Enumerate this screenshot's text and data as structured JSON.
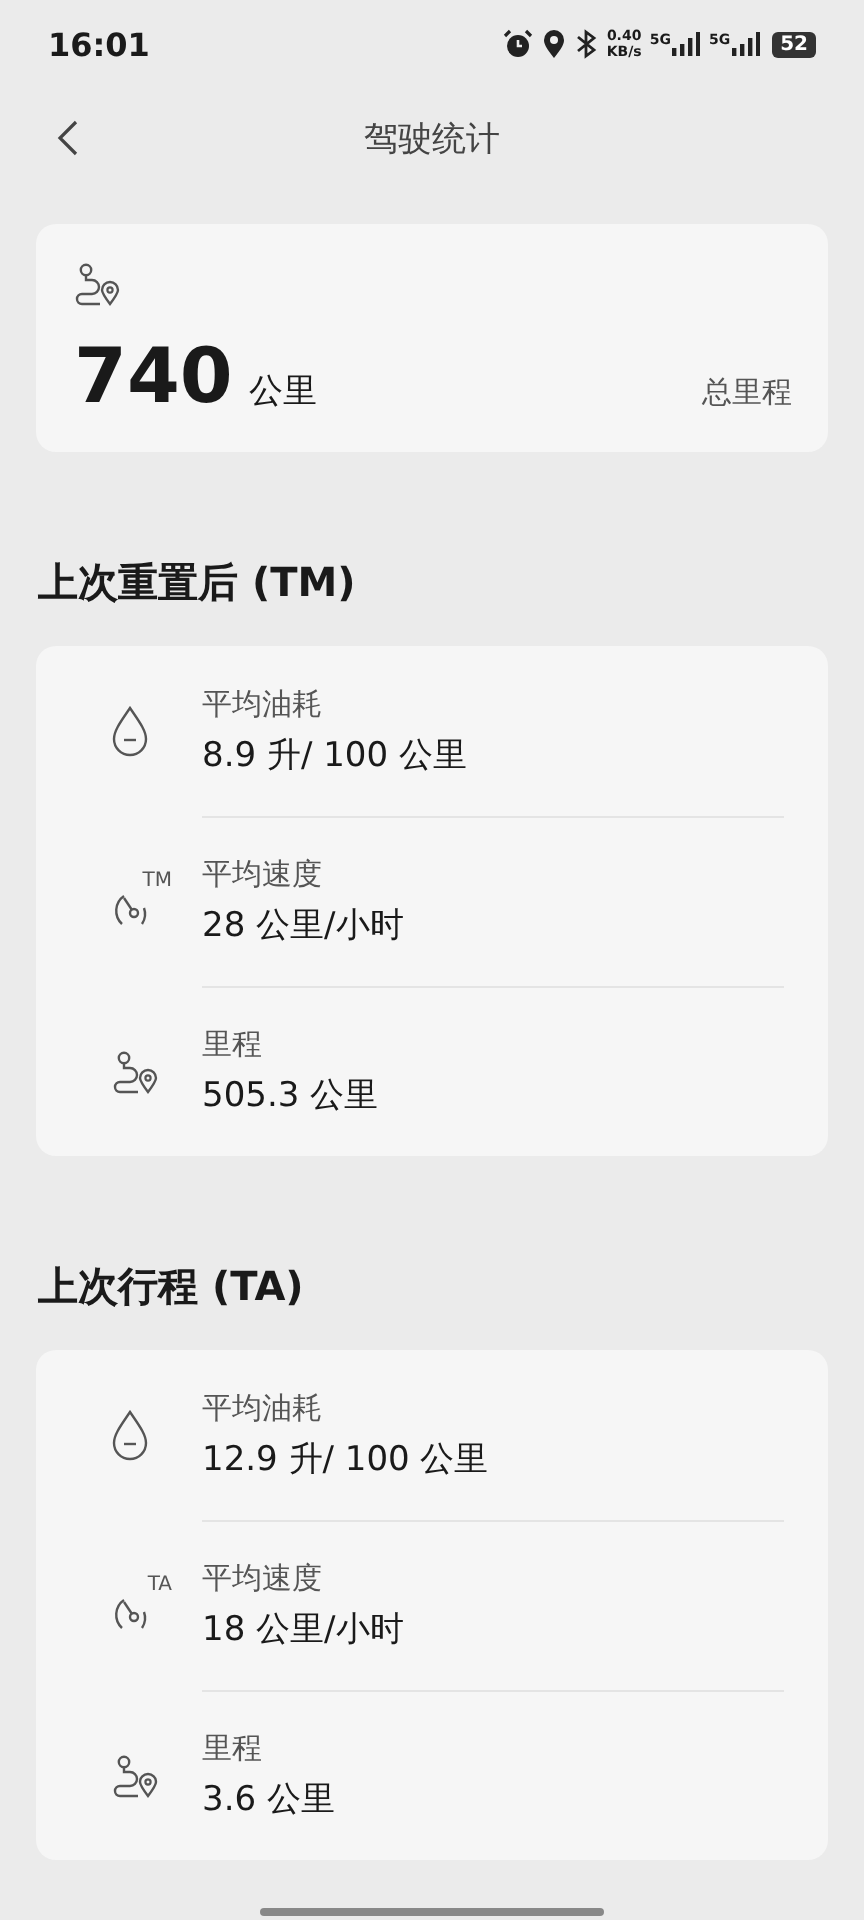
{
  "status_bar": {
    "time": "16:01",
    "net_speed": "0.40",
    "net_unit": "KB/s",
    "sim1": "5G",
    "sim2": "5G",
    "battery": "52"
  },
  "header": {
    "title": "驾驶统计"
  },
  "total": {
    "value": "740",
    "unit": "公里",
    "label": "总里程"
  },
  "sections": [
    {
      "title": "上次重置后 (TM)",
      "items": [
        {
          "kind": "fuel",
          "label": "平均油耗",
          "value": "8.9 升/ 100 公里"
        },
        {
          "kind": "speed",
          "tag": "TM",
          "label": "平均速度",
          "value": "28 公里/小时"
        },
        {
          "kind": "distance",
          "label": "里程",
          "value": "505.3 公里"
        }
      ]
    },
    {
      "title": "上次行程 (TA)",
      "items": [
        {
          "kind": "fuel",
          "label": "平均油耗",
          "value": "12.9 升/ 100 公里"
        },
        {
          "kind": "speed",
          "tag": "TA",
          "label": "平均速度",
          "value": "18 公里/小时"
        },
        {
          "kind": "distance",
          "label": "里程",
          "value": "3.6 公里"
        }
      ]
    }
  ]
}
